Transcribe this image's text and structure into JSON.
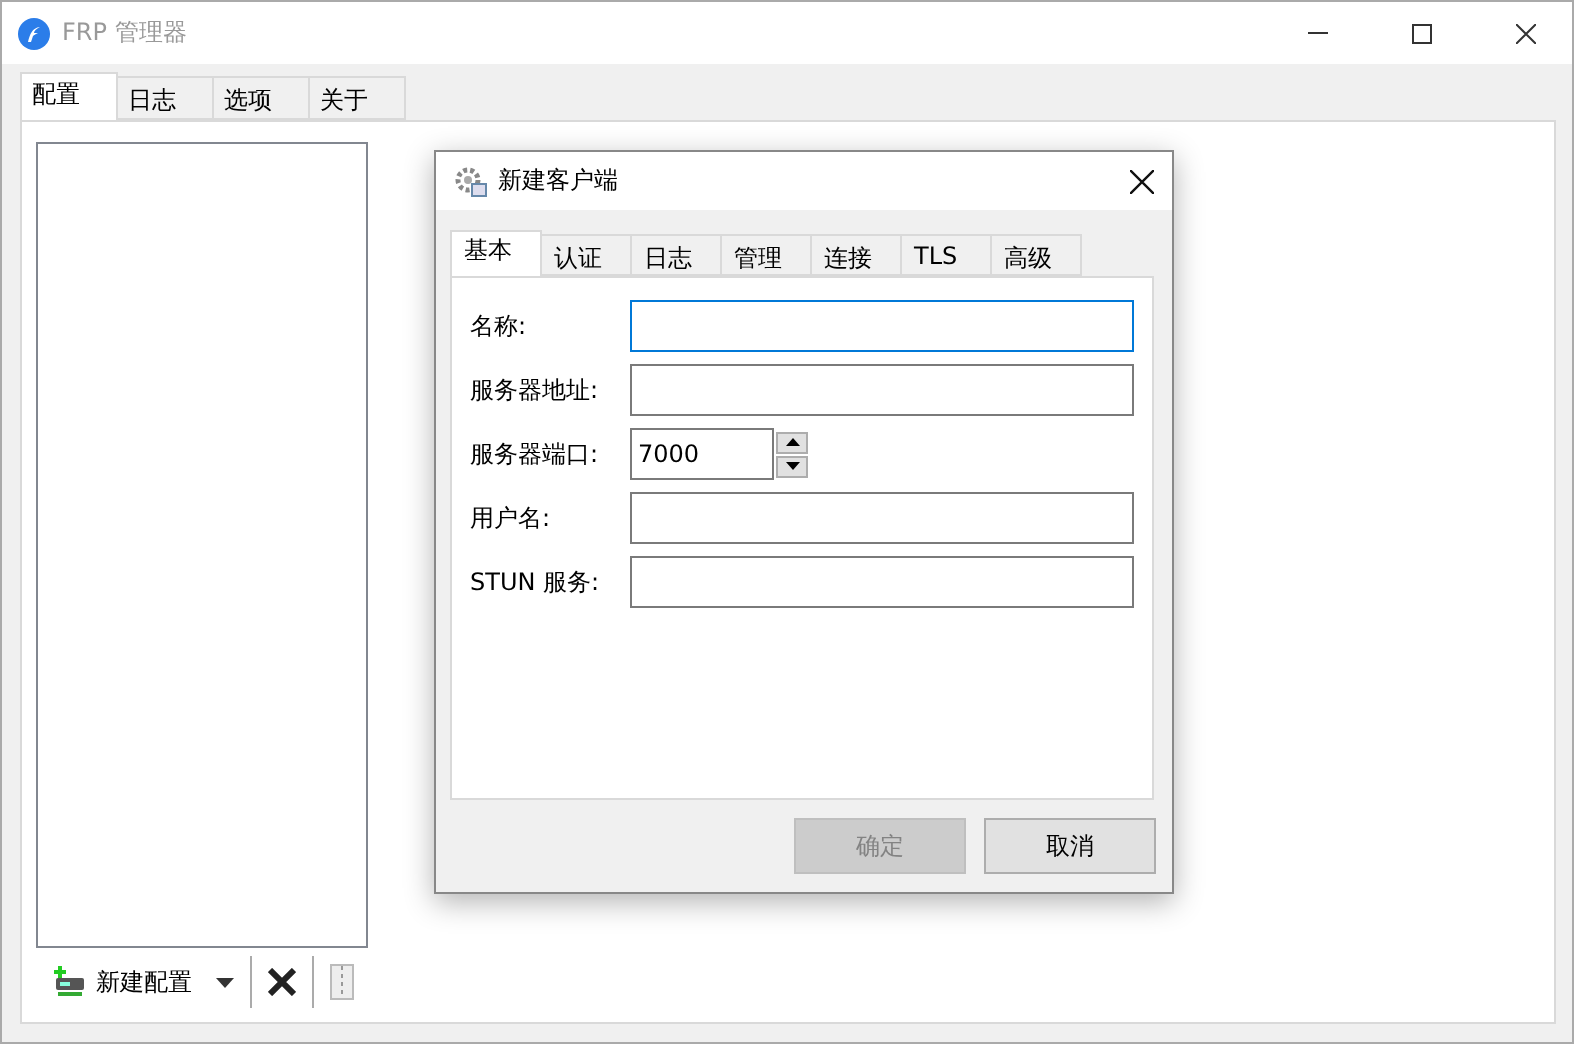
{
  "window": {
    "title": "FRP 管理器"
  },
  "tabs": [
    {
      "label": "配置",
      "selected": true
    },
    {
      "label": "日志",
      "selected": false
    },
    {
      "label": "选项",
      "selected": false
    },
    {
      "label": "关于",
      "selected": false
    }
  ],
  "toolbar": {
    "new_button": "新建配置"
  },
  "dialog": {
    "title": "新建客户端",
    "tabs": [
      {
        "label": "基本",
        "selected": true
      },
      {
        "label": "认证",
        "selected": false
      },
      {
        "label": "日志",
        "selected": false
      },
      {
        "label": "管理",
        "selected": false
      },
      {
        "label": "连接",
        "selected": false
      },
      {
        "label": "TLS",
        "selected": false
      },
      {
        "label": "高级",
        "selected": false
      }
    ],
    "fields": [
      {
        "label": "名称:",
        "kind": "text",
        "focused": true
      },
      {
        "label": "服务器地址:",
        "kind": "text",
        "focused": false
      },
      {
        "label": "服务器端口:",
        "kind": "spin",
        "value": "7000",
        "focused": false
      },
      {
        "label": "用户名:",
        "kind": "text",
        "focused": false
      },
      {
        "label": "STUN 服务:",
        "kind": "text",
        "focused": false
      }
    ],
    "buttons": [
      {
        "label": "确定",
        "disabled": true
      },
      {
        "label": "取消",
        "disabled": false
      }
    ]
  }
}
